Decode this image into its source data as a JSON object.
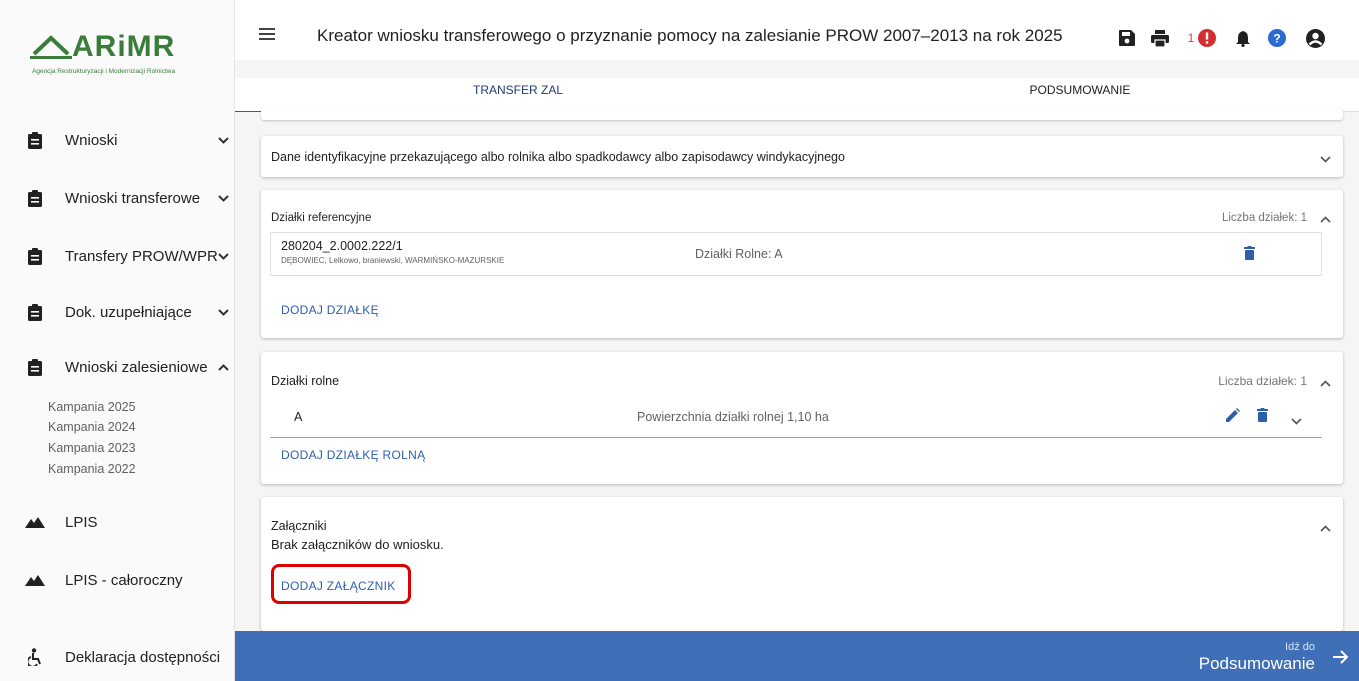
{
  "app": {
    "title": "Kreator wniosku transferowego o przyznanie pomocy na zalesianie PROW 2007–2013 na rok 2025",
    "logo_text": "ARiMR",
    "logo_subtitle": "Agencja Restrukturyzacji i Modernizacji Rolnictwa",
    "notification_count": "1",
    "brand_color": "#3f6fb6",
    "logo_color": "#3a7d3a"
  },
  "sidebar": {
    "items": [
      {
        "label": "Wnioski",
        "icon": "clipboard-icon",
        "chevron": "⌄"
      },
      {
        "label": "Wnioski transferowe",
        "icon": "clipboard-icon",
        "chevron": "⌄"
      },
      {
        "label": "Transfery PROW/WPR",
        "icon": "clipboard-icon",
        "chevron": "⌄"
      },
      {
        "label": "Dok. uzupełniające",
        "icon": "clipboard-icon",
        "chevron": "⌄"
      },
      {
        "label": "Wnioski zalesieniowe",
        "icon": "clipboard-icon",
        "chevron": "^"
      },
      {
        "label": "LPIS",
        "icon": "mountain-icon"
      },
      {
        "label": "LPIS - całoroczny",
        "icon": "mountain-icon"
      },
      {
        "label": "Deklaracja dostępności",
        "icon": "accessibility-icon"
      }
    ],
    "sub_items": [
      "Kampania 2025",
      "Kampania 2024",
      "Kampania 2023",
      "Kampania 2022"
    ]
  },
  "tabs": [
    "TRANSFER ZAL",
    "PODSUMOWANIE"
  ],
  "cards": {
    "identification": {
      "title": "Dane identyfikacyjne przekazującego albo rolnika albo spadkodawcy albo zapisodawcy windykacyjnego"
    },
    "reference_parcels": {
      "title": "Działki referencyjne",
      "count_label": "Liczba działek: 1",
      "row": {
        "id": "280204_2.0002.222/1",
        "location": "DĘBOWIEC, Lelkowo, braniewski, WARMIŃSKO-MAZURSKIE",
        "farm_parcels": "Działki Rolne: A"
      },
      "add_button": "DODAJ DZIAŁKĘ"
    },
    "farm_parcels": {
      "title": "Działki rolne",
      "count_label": "Liczba działek: 1",
      "row": {
        "name": "A",
        "area": "Powierzchnia działki rolnej 1,10 ha"
      },
      "add_button": "DODAJ DZIAŁKĘ ROLNĄ"
    },
    "attachments": {
      "title": "Załączniki",
      "empty_text": "Brak załączników do wniosku.",
      "add_button": "DODAJ ZAŁĄCZNIK"
    }
  },
  "bottom_bar": {
    "small": "Idź do",
    "big": "Podsumowanie"
  }
}
